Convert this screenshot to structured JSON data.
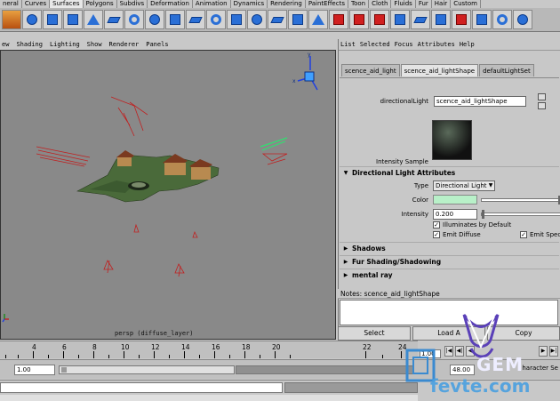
{
  "shelf": {
    "tabs": [
      "neral",
      "Curves",
      "Surfaces",
      "Polygons",
      "Subdivs",
      "Deformation",
      "Animation",
      "Dynamics",
      "Rendering",
      "PaintEffects",
      "Toon",
      "Cloth",
      "Fluids",
      "Fur",
      "Hair",
      "Custom"
    ],
    "active_tab": "Surfaces"
  },
  "panel_menu": [
    "ew",
    "Shading",
    "Lighting",
    "Show",
    "Renderer",
    "Panels"
  ],
  "viewport": {
    "camera_label": "persp (diffuse_layer)"
  },
  "attribute_editor": {
    "menu": [
      "List",
      "Selected",
      "Focus",
      "Attributes",
      "Help"
    ],
    "tabs": [
      "scence_aid_light",
      "scence_aid_lightShape",
      "defaultLightSet"
    ],
    "active_tab": "scence_aid_lightShape",
    "node_type_label": "directionalLight",
    "node_name": "scence_aid_lightShape",
    "sample_label": "Intensity Sample",
    "sections": {
      "directional": "Directional Light Attributes",
      "shadows": "Shadows",
      "fur": "Fur Shading/Shadowing",
      "mental_ray": "mental ray"
    },
    "type_label": "Type",
    "type_value": "Directional Light",
    "color_label": "Color",
    "intensity_label": "Intensity",
    "intensity_value": "0.200",
    "illuminates_label": "Illuminates by Default",
    "emit_diffuse_label": "Emit Diffuse",
    "emit_specular_label": "Emit Spec",
    "color_value": "#b8f0c8"
  },
  "notes": {
    "title": "Notes: scence_aid_lightShape"
  },
  "buttons": {
    "select": "Select",
    "load": "Load A",
    "copy": "Copy"
  },
  "timeline": {
    "tick_labels": [
      "4",
      "6",
      "8",
      "10",
      "12",
      "14",
      "16",
      "18",
      "20",
      "22",
      "24"
    ],
    "current_frame": "1.00"
  },
  "range": {
    "start": "1.00",
    "end": "48.00",
    "char_set": "haracter Se"
  },
  "watermark": {
    "brand": "GEM",
    "site": "fevte.com"
  }
}
